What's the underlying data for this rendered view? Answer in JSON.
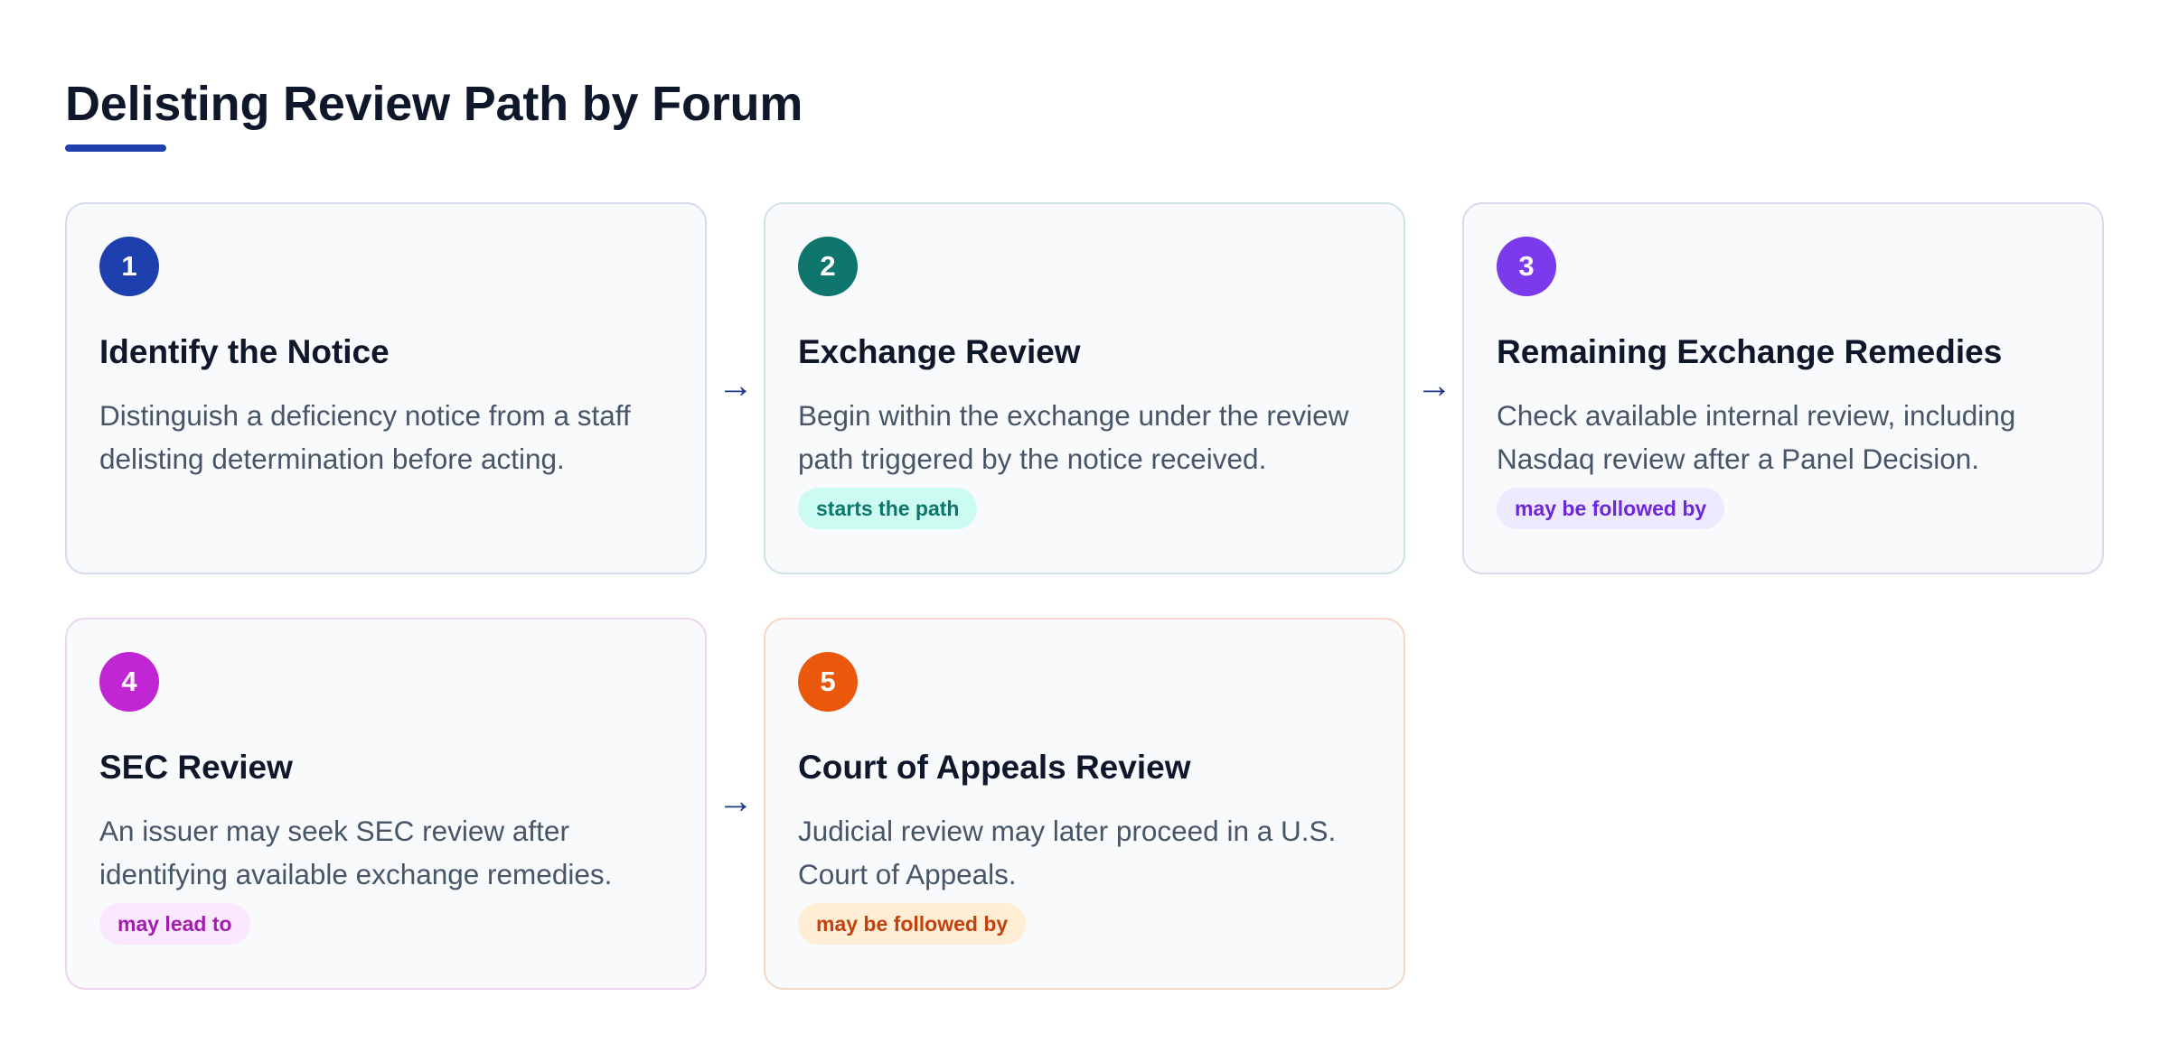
{
  "header": {
    "title": "Delisting Review Path by Forum"
  },
  "steps": [
    {
      "number": "1",
      "title": "Identify the Notice",
      "description": "Distinguish a deficiency notice from a staff delisting determination before acting.",
      "tag": "",
      "accent": "#1e40af",
      "border": "#d6dcef",
      "tag_bg": "",
      "tag_color": ""
    },
    {
      "number": "2",
      "title": "Exchange Review",
      "description": "Begin within the exchange under the review path triggered by the notice received.",
      "tag": "starts the path",
      "accent": "#0f766e",
      "border": "#cfe3e6",
      "tag_bg": "#ccfbf1",
      "tag_color": "#0f766e"
    },
    {
      "number": "3",
      "title": "Remaining Exchange Remedies",
      "description": "Check available internal review, including Nasdaq review after a Panel Decision.",
      "tag": "may be followed by",
      "accent": "#7c3aed",
      "border": "#dcd8f0",
      "tag_bg": "#ede9fe",
      "tag_color": "#6d28d9"
    },
    {
      "number": "4",
      "title": "SEC Review",
      "description": "An issuer may seek SEC review after identifying available exchange remedies.",
      "tag": "may lead to",
      "accent": "#c026d3",
      "border": "#ecd4f0",
      "tag_bg": "#fae8ff",
      "tag_color": "#a21caf"
    },
    {
      "number": "5",
      "title": "Court of Appeals Review",
      "description": "Judicial review may later proceed in a U.S. Court of Appeals.",
      "tag": "may be followed by",
      "accent": "#ea580c",
      "border": "#f5d6c8",
      "tag_bg": "#ffedd5",
      "tag_color": "#c2410c"
    }
  ],
  "connectors": {
    "arrow_glyph": "→",
    "color": "#1e3a8a"
  }
}
